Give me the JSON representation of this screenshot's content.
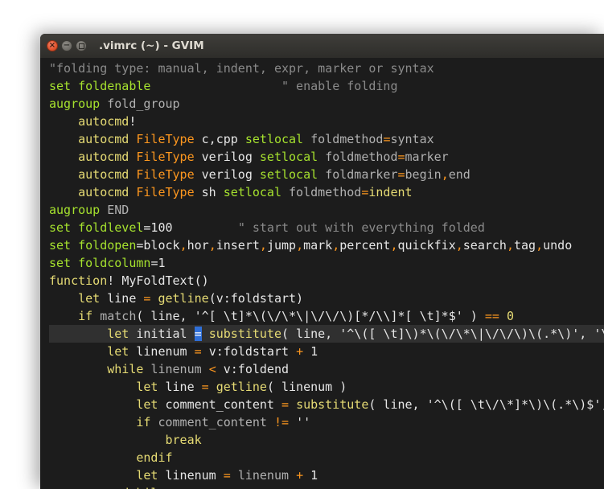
{
  "window": {
    "title": ".vimrc (~) - GVIM",
    "close_glyph": "×",
    "min_glyph": "−"
  },
  "colors": {
    "comment": "#8a8a8a",
    "keyword": "#a6e22e",
    "statement": "#e6db74",
    "type": "#fd971f",
    "identifier": "#e6e6e6",
    "option": "#b0b0b0",
    "operator": "#f92672",
    "string": "#cfcfcf",
    "number": "#e6e6e6",
    "cursor_bg": "#2f6fd8",
    "background": "#1c1c1c"
  },
  "editor": {
    "lines": [
      [
        [
          "\"folding type: manual, indent, expr, marker or syntax",
          "comment"
        ]
      ],
      [
        [
          "set ",
          "kw"
        ],
        [
          "foldenable",
          "green"
        ],
        [
          "                  ",
          "plain"
        ],
        [
          "\" enable folding",
          "comment"
        ]
      ],
      [
        [
          "augroup ",
          "kw"
        ],
        [
          "fold_group",
          "cmt2"
        ]
      ],
      [
        [
          "    ",
          "plain"
        ],
        [
          "autocmd",
          "orange"
        ],
        [
          "!",
          "plain"
        ]
      ],
      [
        [
          "    ",
          "plain"
        ],
        [
          "autocmd ",
          "orange"
        ],
        [
          "FileType ",
          "pink"
        ],
        [
          "c,cpp ",
          "plain"
        ],
        [
          "setlocal ",
          "kw"
        ],
        [
          "foldmethod",
          "cmt2"
        ],
        [
          "=",
          "pink"
        ],
        [
          "syntax",
          "cmt2"
        ]
      ],
      [
        [
          "    ",
          "plain"
        ],
        [
          "autocmd ",
          "orange"
        ],
        [
          "FileType ",
          "pink"
        ],
        [
          "verilog ",
          "plain"
        ],
        [
          "setlocal ",
          "kw"
        ],
        [
          "foldmethod",
          "cmt2"
        ],
        [
          "=",
          "pink"
        ],
        [
          "marker",
          "cmt2"
        ]
      ],
      [
        [
          "    ",
          "plain"
        ],
        [
          "autocmd ",
          "orange"
        ],
        [
          "FileType ",
          "pink"
        ],
        [
          "verilog ",
          "plain"
        ],
        [
          "setlocal ",
          "kw"
        ],
        [
          "foldmarker",
          "cmt2"
        ],
        [
          "=",
          "pink"
        ],
        [
          "begin",
          "cmt2"
        ],
        [
          ",",
          "pink"
        ],
        [
          "end",
          "cmt2"
        ]
      ],
      [
        [
          "    ",
          "plain"
        ],
        [
          "autocmd ",
          "orange"
        ],
        [
          "FileType ",
          "pink"
        ],
        [
          "sh ",
          "plain"
        ],
        [
          "setlocal ",
          "kw"
        ],
        [
          "foldmethod",
          "cmt2"
        ],
        [
          "=",
          "pink"
        ],
        [
          "indent",
          "orange"
        ]
      ],
      [
        [
          "augroup ",
          "kw"
        ],
        [
          "END",
          "cmt2"
        ]
      ],
      [
        [
          "set ",
          "kw"
        ],
        [
          "foldlevel",
          "green"
        ],
        [
          "=100",
          "plain"
        ],
        [
          "         ",
          "plain"
        ],
        [
          "\" start out with everything folded",
          "comment"
        ]
      ],
      [
        [
          "set ",
          "kw"
        ],
        [
          "foldopen",
          "green"
        ],
        [
          "=block",
          "plain"
        ],
        [
          ",",
          "pink"
        ],
        [
          "hor",
          "plain"
        ],
        [
          ",",
          "pink"
        ],
        [
          "insert",
          "plain"
        ],
        [
          ",",
          "pink"
        ],
        [
          "jump",
          "plain"
        ],
        [
          ",",
          "pink"
        ],
        [
          "mark",
          "plain"
        ],
        [
          ",",
          "pink"
        ],
        [
          "percent",
          "plain"
        ],
        [
          ",",
          "pink"
        ],
        [
          "quickfix",
          "plain"
        ],
        [
          ",",
          "pink"
        ],
        [
          "search",
          "plain"
        ],
        [
          ",",
          "pink"
        ],
        [
          "tag",
          "plain"
        ],
        [
          ",",
          "pink"
        ],
        [
          "undo",
          "plain"
        ]
      ],
      [
        [
          "set ",
          "kw"
        ],
        [
          "foldcolumn",
          "green"
        ],
        [
          "=1",
          "plain"
        ]
      ],
      [
        [
          "function",
          "orange"
        ],
        [
          "! ",
          "plain"
        ],
        [
          "MyFoldText",
          "plain"
        ],
        [
          "()",
          "plain"
        ]
      ],
      [
        [
          "    ",
          "plain"
        ],
        [
          "let ",
          "orange"
        ],
        [
          "line ",
          "plain"
        ],
        [
          "= ",
          "pink"
        ],
        [
          "getline",
          "orange"
        ],
        [
          "(v:foldstart)",
          "plain"
        ]
      ],
      [
        [
          "    ",
          "plain"
        ],
        [
          "if ",
          "orange"
        ],
        [
          "match",
          "cmt2"
        ],
        [
          "( line, '^[ \\t]*\\(\\/\\*\\|\\/\\/\\)[*/\\\\]*[ \\t]*$' ) ",
          "plain"
        ],
        [
          "== ",
          "pink"
        ],
        [
          "0",
          "orange"
        ]
      ],
      [
        [
          "        ",
          "plain"
        ],
        [
          "let ",
          "orange"
        ],
        [
          "initial ",
          "plain"
        ],
        [
          "=",
          "cursor"
        ],
        [
          " ",
          "plain"
        ],
        [
          "substitute",
          "orange"
        ],
        [
          "( line, '^\\([ \\t]\\)*\\(\\/\\*\\|\\/\\/\\)\\(.*\\)', '\\",
          "plain"
        ]
      ],
      [
        [
          "        ",
          "plain"
        ],
        [
          "let ",
          "orange"
        ],
        [
          "linenum ",
          "plain"
        ],
        [
          "= ",
          "pink"
        ],
        [
          "v:foldstart ",
          "plain"
        ],
        [
          "+ ",
          "pink"
        ],
        [
          "1",
          "plain"
        ]
      ],
      [
        [
          "        ",
          "plain"
        ],
        [
          "while ",
          "orange"
        ],
        [
          "linenum ",
          "cmt2"
        ],
        [
          "< ",
          "pink"
        ],
        [
          "v:foldend",
          "plain"
        ]
      ],
      [
        [
          "            ",
          "plain"
        ],
        [
          "let ",
          "orange"
        ],
        [
          "line ",
          "plain"
        ],
        [
          "= ",
          "pink"
        ],
        [
          "getline",
          "orange"
        ],
        [
          "( linenum )",
          "plain"
        ]
      ],
      [
        [
          "            ",
          "plain"
        ],
        [
          "let ",
          "orange"
        ],
        [
          "comment_content ",
          "plain"
        ],
        [
          "= ",
          "pink"
        ],
        [
          "substitute",
          "orange"
        ],
        [
          "( line, '^\\([ \\t\\/\\*]*\\)\\(.*\\)$',",
          "plain"
        ]
      ],
      [
        [
          "            ",
          "plain"
        ],
        [
          "if ",
          "orange"
        ],
        [
          "comment_content ",
          "cmt2"
        ],
        [
          "!= ",
          "pink"
        ],
        [
          "''",
          "plain"
        ]
      ],
      [
        [
          "                ",
          "plain"
        ],
        [
          "break",
          "orange"
        ]
      ],
      [
        [
          "            ",
          "plain"
        ],
        [
          "endif",
          "orange"
        ]
      ],
      [
        [
          "            ",
          "plain"
        ],
        [
          "let ",
          "orange"
        ],
        [
          "linenum ",
          "plain"
        ],
        [
          "= ",
          "pink"
        ],
        [
          "linenum ",
          "cmt2"
        ],
        [
          "+ ",
          "pink"
        ],
        [
          "1",
          "plain"
        ]
      ],
      [
        [
          "        ",
          "plain"
        ],
        [
          "endwhile",
          "orange"
        ]
      ]
    ]
  }
}
